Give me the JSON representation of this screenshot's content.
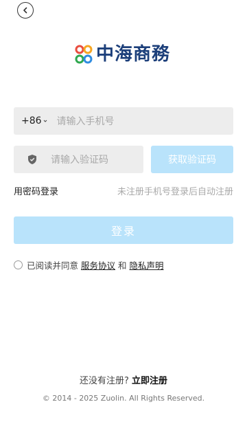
{
  "header": {
    "back_icon": "chevron-left-icon"
  },
  "logo": {
    "text": "中海商務",
    "mark_colors": [
      "#e94d3f",
      "#f6a623",
      "#2fa84f",
      "#2f8ce0"
    ]
  },
  "phone": {
    "country_code": "+86",
    "placeholder": "请输入手机号"
  },
  "code": {
    "icon": "shield-icon",
    "placeholder": "请输入验证码",
    "get_code_label": "获取验证码"
  },
  "options": {
    "password_login": "用密码登录",
    "auto_register_tip": "未注册手机号登录后自动注册"
  },
  "login": {
    "label": "登录"
  },
  "agreement": {
    "prefix": "已阅读并同意",
    "service_link": "服务协议",
    "and": "和",
    "privacy_link": "隐私声明"
  },
  "footer": {
    "no_account": "还没有注册?",
    "register_link": "立即注册",
    "copyright": "© 2014 - 2025 Zuolin. All Rights Reserved."
  },
  "colors": {
    "accent_disabled": "#b9e3fb",
    "brand_text": "#1c3f7a",
    "field_bg": "#ededed"
  }
}
